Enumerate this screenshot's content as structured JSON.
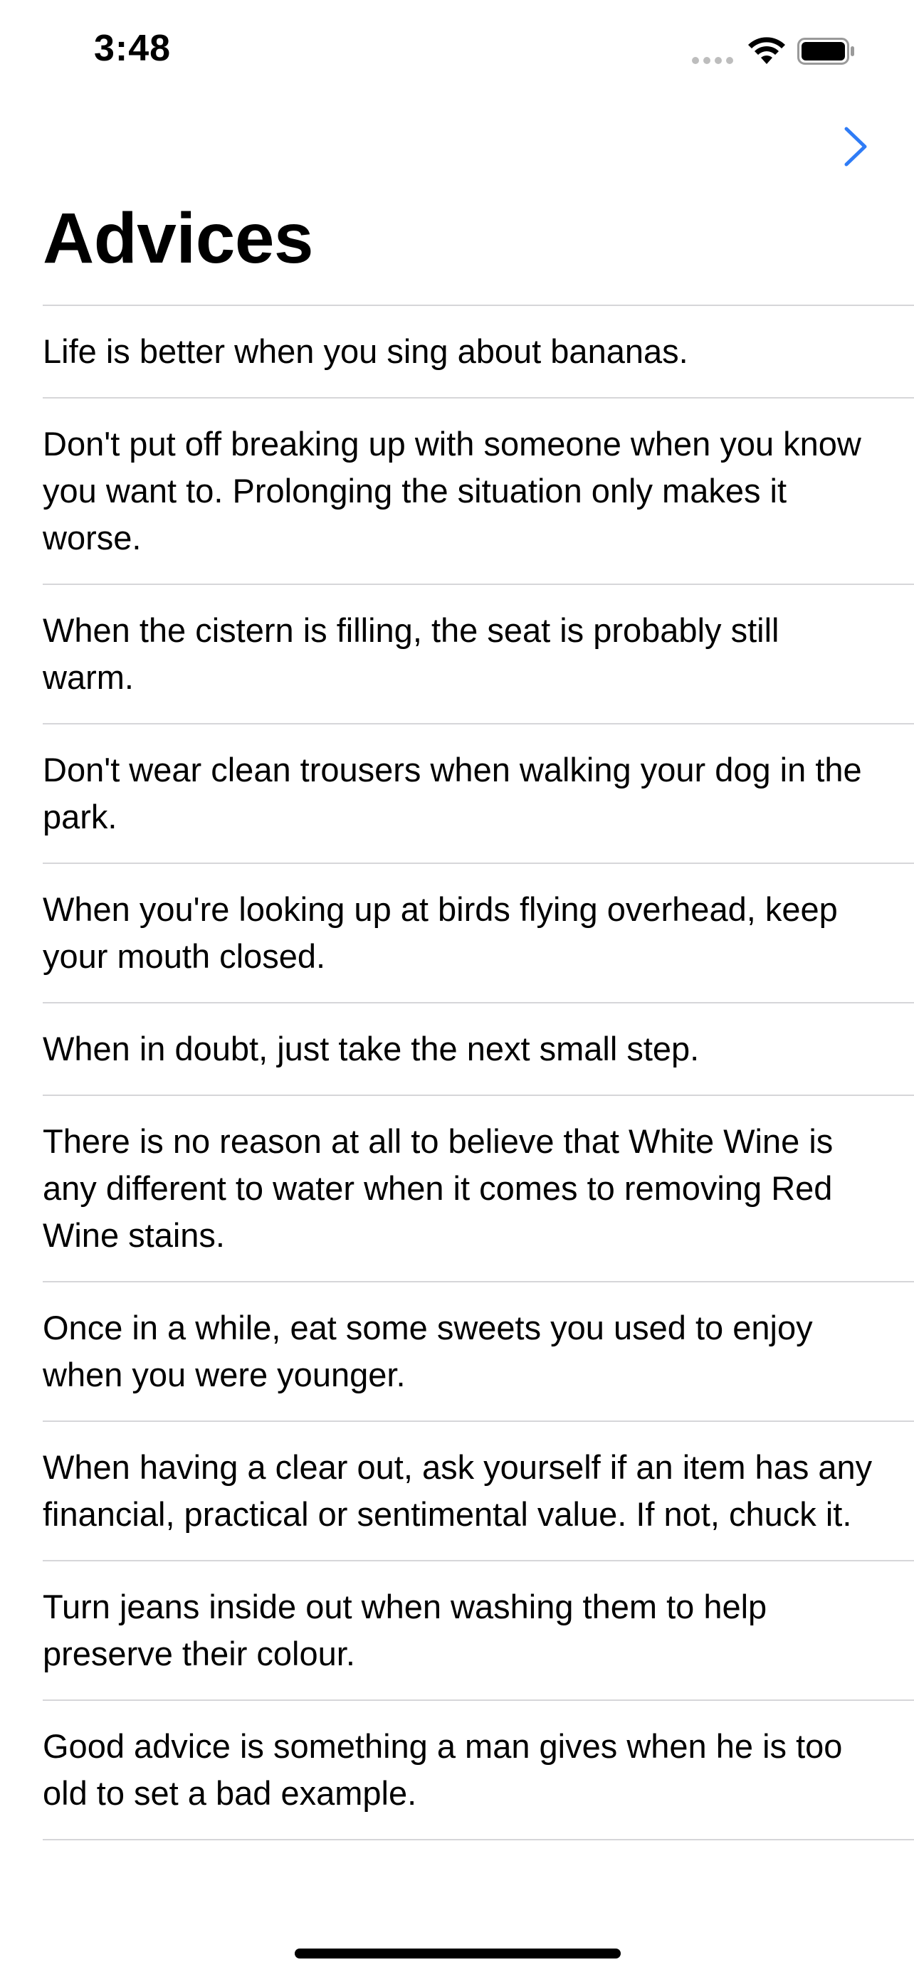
{
  "status_bar": {
    "time": "3:48"
  },
  "nav": {
    "forward_icon": "chevron-right-icon",
    "accent_color": "#2f7cf6"
  },
  "page": {
    "title": "Advices"
  },
  "advices": [
    "Life is better when you sing about bananas.",
    "Don't put off breaking up with someone when you know you want to. Prolonging the situation only makes it worse.",
    "When the cistern is filling, the seat is probably still warm.",
    "Don't wear clean trousers when walking your dog in the park.",
    "When you're looking up at birds flying overhead, keep your mouth closed.",
    "When in doubt, just take the next small step.",
    "There is no reason at all to believe that White Wine is any different to water when it comes to removing Red Wine stains.",
    "Once in a while, eat some sweets you used to enjoy when you were younger.",
    "When having a clear out, ask yourself if an item has any financial, practical or sentimental value. If not, chuck it.",
    "Turn jeans inside out when washing them to help preserve their colour.",
    "Good advice is something a man gives when he is too old to set a bad example."
  ]
}
